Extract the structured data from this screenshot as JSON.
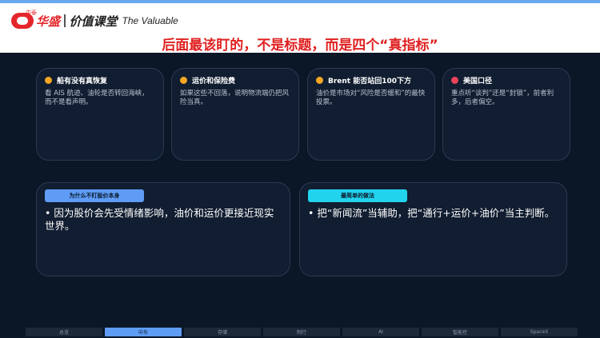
{
  "header": {
    "logo_small": "中泰",
    "logo_cn": "华盛",
    "logo_course": "价值课堂",
    "logo_en": "The Valuable",
    "headline": "后面最该盯的，不是标题，而是四个“真指标”"
  },
  "cards": [
    {
      "title": "船有没有真恢复",
      "body": "看 AIS 航迹、油轮是否转回海峡，而不是看声明。",
      "color": "#f5a623"
    },
    {
      "title": "运价和保险费",
      "body": "如果这些不回落，说明物流端仍把风险当真。",
      "color": "#f5a623"
    },
    {
      "title": "Brent 能否站回100下方",
      "body": "油价是市场对“风险是否缓和”的最快投票。",
      "color": "#f5a623"
    },
    {
      "title": "美国口径",
      "body": "重点听“谈判”还是“封锁”，前者利多，后者偏空。",
      "color": "#e8435a"
    }
  ],
  "panels": [
    {
      "tag": "为什么不盯股价本身",
      "body": "• 因为股价会先受情绪影响，油价和运价更接近现实世界。",
      "color": "#5e9cf5"
    },
    {
      "tag": "最简单的做法",
      "body": "• 把“新闻流”当辅助，把“通行+运价+油价”当主判断。",
      "color": "#22d3ee"
    }
  ],
  "nav": {
    "items": [
      "总览",
      "中东",
      "存储",
      "制行",
      "AI",
      "智能控",
      "SpaceX"
    ],
    "active_index": 1
  }
}
